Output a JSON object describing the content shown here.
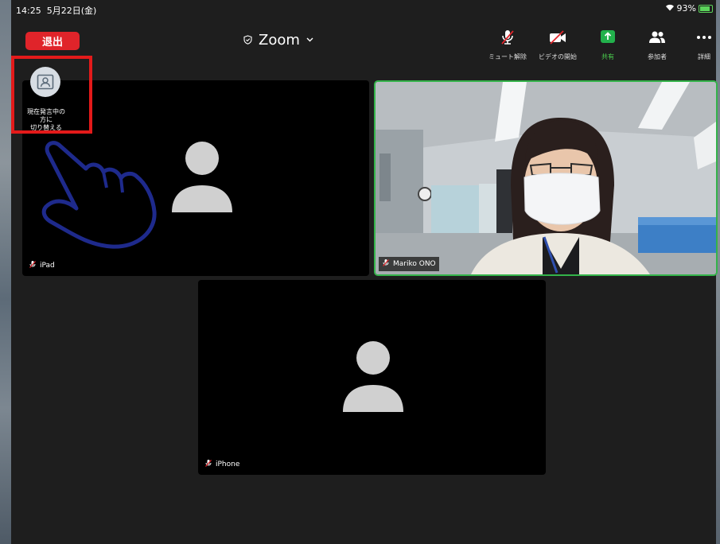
{
  "status_bar": {
    "time": "14:25",
    "date": "5月22日(金)",
    "battery": "93%"
  },
  "header": {
    "exit_label": "退出",
    "meeting_title": "Zoom"
  },
  "toolbar": {
    "unmute": "ミュート解除",
    "start_video": "ビデオの開始",
    "share": "共有",
    "participants": "参加者",
    "more": "詳細"
  },
  "view_switch": {
    "label_line1": "現在発言中の",
    "label_line2": "方に",
    "label_line3": "切り替える"
  },
  "participants": [
    {
      "name": "iPad",
      "muted": true,
      "video": false
    },
    {
      "name": "Mariko ONO",
      "muted": true,
      "video": true,
      "active_speaker": true
    },
    {
      "name": "iPhone",
      "muted": true,
      "video": false
    }
  ],
  "colors": {
    "exit_red": "#e0242a",
    "share_green": "#22b14c",
    "highlight_red": "#e31a1a",
    "hand_outline": "#1e2a8c"
  }
}
